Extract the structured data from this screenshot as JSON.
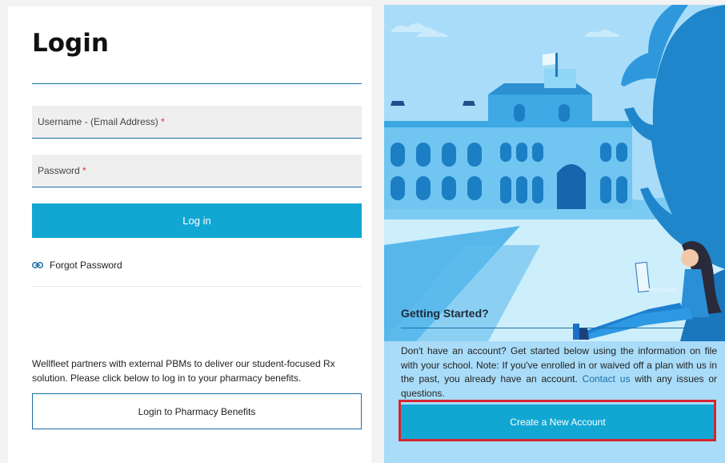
{
  "login": {
    "title": "Login",
    "username_label": "Username - (Email Address)",
    "password_label": "Password",
    "required_marker": "*",
    "login_button": "Log in",
    "forgot_password": "Forgot Password",
    "pbm_text": "Wellfleet partners with external PBMs to deliver our student-focused Rx solution. Please click below to log in to your pharmacy benefits.",
    "pbm_button": "Login to Pharmacy Benefits"
  },
  "getting_started": {
    "title": "Getting Started?",
    "text_before_link": "Don't have an account? Get started below using the information on file with your school. Note: If you've enrolled in or waived off a plan with us in the past, you already have an account.",
    "link_text": "Contact us",
    "text_after_link": "with any issues or questions.",
    "create_button": "Create a New Account"
  },
  "colors": {
    "accent": "#12a7d3",
    "rule": "#1a6fa8",
    "highlight": "#d7252f",
    "illustration_bg": "#a9dcf8"
  },
  "icons": {
    "forgot": "link-icon"
  }
}
